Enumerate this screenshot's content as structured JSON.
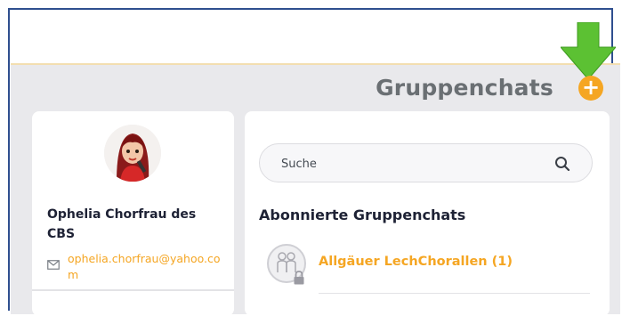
{
  "header": {
    "title": "Gruppenchats",
    "add_button_label": "+",
    "add_button_icon": "plus-icon",
    "accent_color": "#f5a623",
    "annotation_arrow_color": "#5cc133"
  },
  "profile": {
    "name": "Ophelia Chorfrau des CBS",
    "email": "ophelia.chorfrau@yahoo.com",
    "email_icon": "envelope-icon",
    "avatar_icon": "user-avatar"
  },
  "main": {
    "search": {
      "placeholder": "Suche",
      "icon": "search-icon"
    },
    "section_title": "Abonnierte Gruppenchats",
    "chats": [
      {
        "name": "Allgäuer LechChorallen (1)",
        "icon": "group-icon",
        "locked": true
      }
    ]
  }
}
